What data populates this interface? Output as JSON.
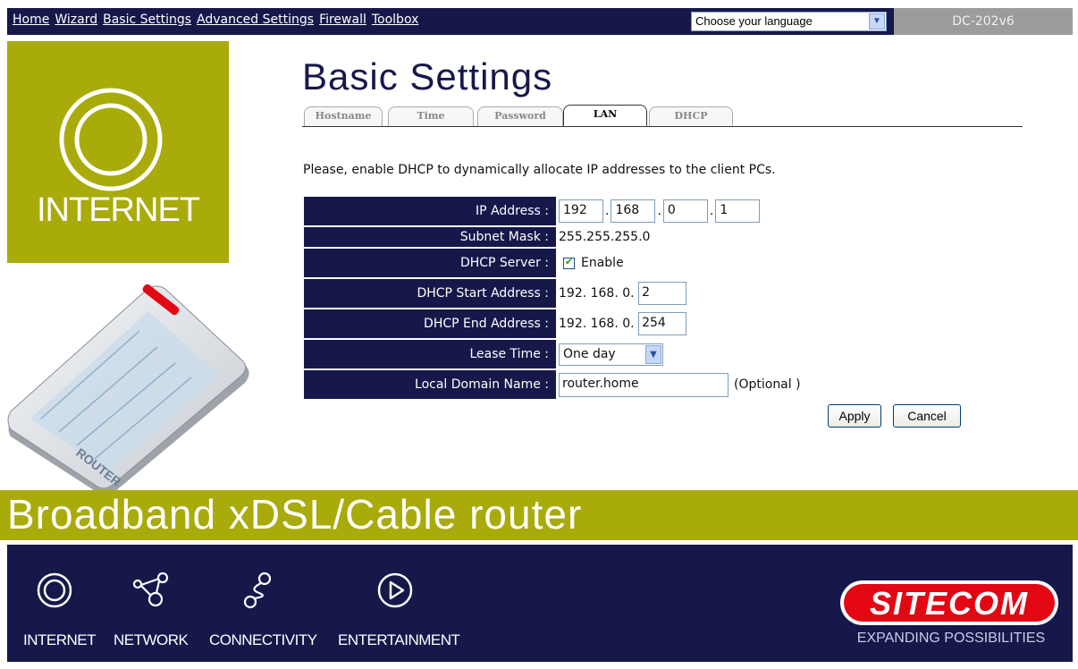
{
  "nav": {
    "links": [
      "Home",
      "Wizard",
      "Basic Settings",
      "Advanced Settings",
      "Firewall",
      "Toolbox"
    ],
    "language_select": "Choose your language",
    "model": "DC-202v6"
  },
  "sidebar": {
    "internet_label": "INTERNET",
    "router_label": "ROUTER",
    "router_brand": "SITECOM"
  },
  "page": {
    "title": "Basic Settings",
    "tabs": [
      "Hostname",
      "Time",
      "Password",
      "LAN",
      "DHCP"
    ],
    "active_tab": "LAN",
    "intro": "Please, enable DHCP to dynamically allocate IP addresses to the client PCs."
  },
  "form": {
    "ip_address": {
      "label": "IP Address :",
      "octets": [
        "192",
        "168",
        "0",
        "1"
      ]
    },
    "subnet_mask": {
      "label": "Subnet Mask :",
      "value": "255.255.255.0"
    },
    "dhcp_server": {
      "label": "DHCP Server :",
      "checked": true,
      "option": "Enable"
    },
    "dhcp_start": {
      "label": "DHCP Start Address :",
      "prefix": "192. 168. 0.",
      "value": "2"
    },
    "dhcp_end": {
      "label": "DHCP End Address :",
      "prefix": "192. 168. 0.",
      "value": "254"
    },
    "lease_time": {
      "label": "Lease Time :",
      "value": "One day"
    },
    "local_domain": {
      "label": "Local Domain Name :",
      "value": "router.home",
      "note": "(Optional )"
    }
  },
  "buttons": {
    "apply": "Apply",
    "cancel": "Cancel"
  },
  "banner": {
    "product": "Broadband xDSL/Cable router"
  },
  "footer": {
    "items": [
      "INTERNET",
      "NETWORK",
      "CONNECTIVITY",
      "ENTERTAINMENT"
    ],
    "brand": "SITECOM",
    "tagline": "EXPANDING POSSIBILITIES"
  },
  "colors": {
    "navy": "#16184a",
    "olive": "#a9ab0b",
    "brand_red": "#e30613"
  }
}
